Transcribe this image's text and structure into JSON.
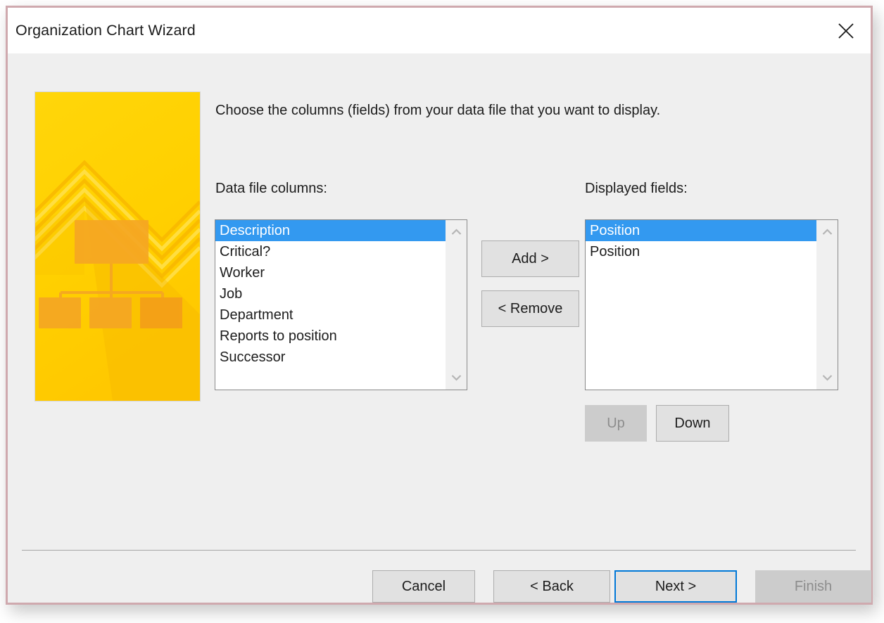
{
  "window": {
    "title": "Organization Chart Wizard",
    "close_icon": "close-icon",
    "border_color": "#cfa9ae",
    "body_color": "#efefef",
    "titlebar_color": "#ffffff"
  },
  "graphic": {
    "name": "org-chart-wizard-illustration",
    "base_color": "#FFD400",
    "accent_color": "#F9A825",
    "shadow_color": "#F5B301"
  },
  "main": {
    "instruction": "Choose the columns (fields) from your data file that you want to display."
  },
  "left_list": {
    "label": "Data file columns:",
    "items": [
      {
        "text": "Description",
        "selected": true
      },
      {
        "text": "Critical?",
        "selected": false
      },
      {
        "text": "Worker",
        "selected": false
      },
      {
        "text": "Job",
        "selected": false
      },
      {
        "text": "Department",
        "selected": false
      },
      {
        "text": "Reports to position",
        "selected": false
      },
      {
        "text": "Successor",
        "selected": false
      }
    ],
    "scroll_up_icon": "chevron-up-icon",
    "scroll_down_icon": "chevron-down-icon"
  },
  "right_list": {
    "label": "Displayed fields:",
    "items": [
      {
        "text": "Position",
        "selected": true
      },
      {
        "text": "Position",
        "selected": false
      }
    ],
    "scroll_up_icon": "chevron-up-icon",
    "scroll_down_icon": "chevron-down-icon"
  },
  "transfer_buttons": {
    "add": "Add >",
    "remove": "< Remove"
  },
  "order_buttons": {
    "up": "Up",
    "down": "Down"
  },
  "footer": {
    "cancel": "Cancel",
    "back": "< Back",
    "next": "Next >",
    "finish": "Finish"
  },
  "colors": {
    "selection_blue": "#3399f0",
    "focus_blue": "#0078d7",
    "button_face": "#e1e1e1",
    "button_border": "#adadad",
    "disabled_face": "#cccccc",
    "disabled_text": "#8d8d8d"
  }
}
